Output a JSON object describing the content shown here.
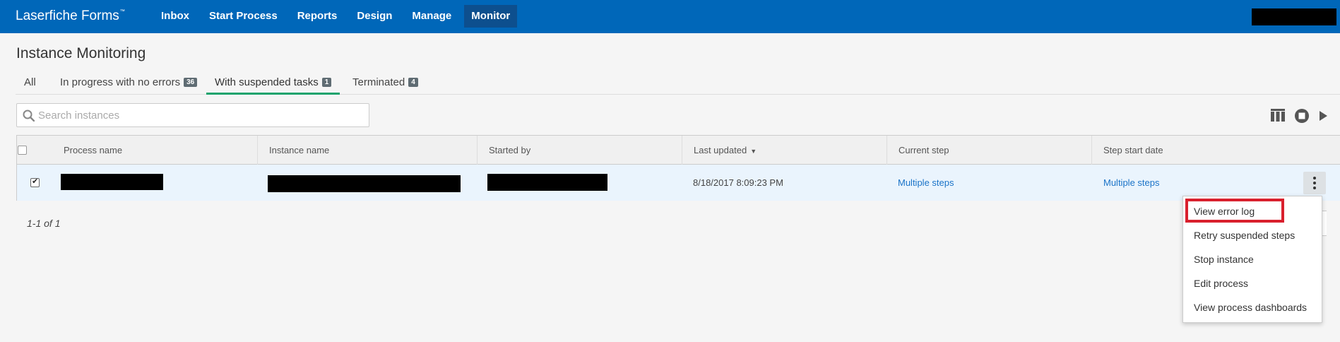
{
  "brand": {
    "name": "Laserfiche Forms",
    "tm": "™"
  },
  "nav": [
    {
      "label": "Inbox",
      "active": false
    },
    {
      "label": "Start Process",
      "active": false
    },
    {
      "label": "Reports",
      "active": false
    },
    {
      "label": "Design",
      "active": false
    },
    {
      "label": "Manage",
      "active": false
    },
    {
      "label": "Monitor",
      "active": true
    }
  ],
  "page": {
    "title": "Instance Monitoring"
  },
  "tabs": [
    {
      "label": "All",
      "badge": ""
    },
    {
      "label": "In progress with no errors",
      "badge": "36"
    },
    {
      "label": "With suspended tasks",
      "badge": "1"
    },
    {
      "label": "Terminated",
      "badge": "4"
    }
  ],
  "search": {
    "placeholder": "Search instances",
    "value": ""
  },
  "toolbar": {
    "icons": [
      "columns-icon",
      "stop-icon",
      "play-icon"
    ]
  },
  "table": {
    "columns": [
      "Process name",
      "Instance name",
      "Started by",
      "Last updated",
      "Current step",
      "Step start date"
    ],
    "sort_column": "Last updated",
    "sort_direction": "descending",
    "rows": [
      {
        "selected": true,
        "process_name": "",
        "instance_name": "",
        "started_by": "",
        "last_updated": "8/18/2017 8:09:23 PM",
        "current_step": "Multiple steps",
        "step_start_date": "Multiple steps"
      }
    ]
  },
  "pagination": {
    "text": "1-1 of 1"
  },
  "context_menu": {
    "items": [
      "View error log",
      "Retry suspended steps",
      "Stop instance",
      "Edit process",
      "View process dashboards"
    ],
    "highlighted": "View error log",
    "highlight_color": "#d9202d"
  },
  "colors": {
    "topbar": "#0067b9",
    "active_nav": "#0d4f8e",
    "tab_underline": "#1aa36d",
    "link": "#1a73c8"
  }
}
